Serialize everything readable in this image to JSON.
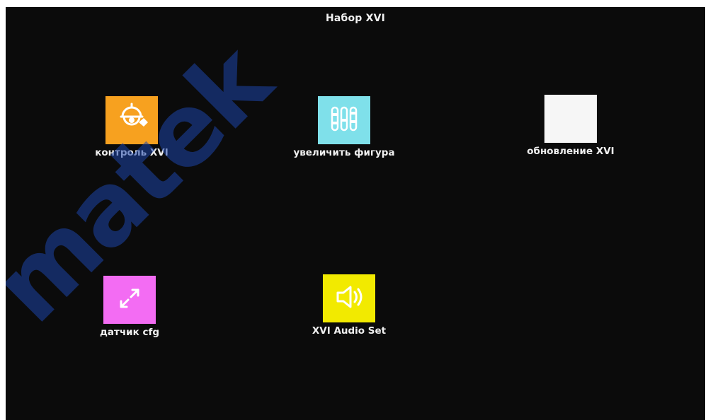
{
  "window": {
    "title": "Набор XVI"
  },
  "tiles": [
    {
      "label": "контроль XVI",
      "icon": "camera-control-icon",
      "color": "#f7a11f"
    },
    {
      "label": "увеличить фигура",
      "icon": "zoom-bars-icon",
      "color": "#7fe0ea"
    },
    {
      "label": "обновление XVI",
      "icon": "update-icon",
      "color": "#f6f6f6"
    },
    {
      "label": "датчик cfg",
      "icon": "expand-arrows-icon",
      "color": "#f36cf3"
    },
    {
      "label": "XVI Audio Set",
      "icon": "speaker-icon",
      "color": "#f2ea00"
    }
  ],
  "watermark": {
    "text": "matek",
    "color": "#2b56b6"
  }
}
